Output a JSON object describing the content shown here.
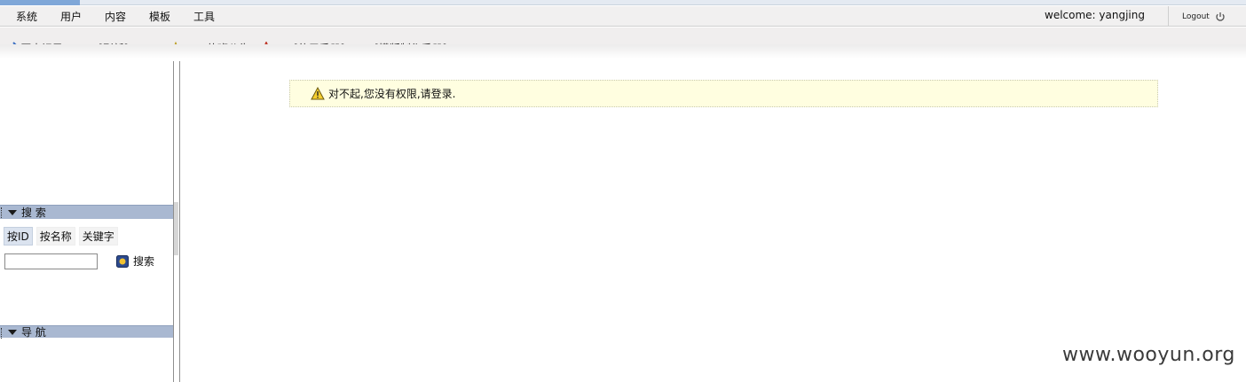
{
  "menubar": {
    "items": [
      "系统",
      "用户",
      "内容",
      "模板",
      "工具"
    ],
    "welcome": "welcome: yangjing",
    "logout": "Logout"
  },
  "toolbar": {
    "items": [
      {
        "label": "历史记录",
        "icon": "history-icon"
      },
      {
        "label": "[刷新]",
        "icon": "refresh-icon"
      },
      {
        "label": "值班公告",
        "icon": "star-icon"
      },
      {
        "label": "[使用手册]",
        "icon": "manual-icon"
      },
      {
        "label": "[模版制作手册]",
        "icon": "template-manual-icon"
      }
    ]
  },
  "sidebar": {
    "search_panel_title": "搜 索",
    "search_tabs": [
      "按ID",
      "按名称",
      "关键字"
    ],
    "search_input_value": "",
    "search_button": "搜索",
    "nav_panel_title": "导 航"
  },
  "main": {
    "alert_message": "对不起,您没有权限,请登录."
  },
  "watermark": "www.wooyun.org",
  "colors": {
    "panel_header": "#a9b8d1",
    "alert_bg": "#fffee0",
    "menubar_bg": "#f1f0f0"
  }
}
